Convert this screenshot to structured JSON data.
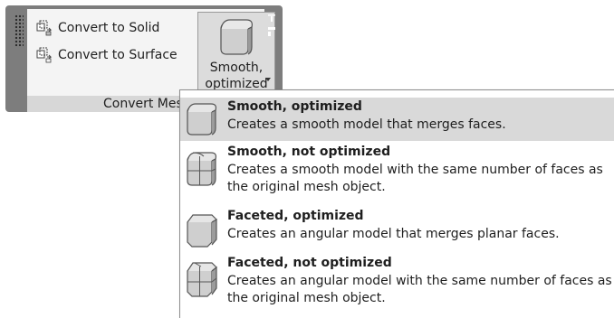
{
  "ribbon": {
    "convert_to_solid": "Convert to Solid",
    "convert_to_surface": "Convert to Surface",
    "smooth_button_line1": "Smooth,",
    "smooth_button_line2": "optimized",
    "panel_title": "Convert Mes"
  },
  "menu": {
    "options": [
      {
        "title": "Smooth, optimized",
        "desc": "Creates a smooth model that merges faces.",
        "icon": "smooth-cube-icon"
      },
      {
        "title": "Smooth, not optimized",
        "desc": "Creates a smooth model with the same number of faces as the original mesh object.",
        "icon": "smooth-grid-cube-icon"
      },
      {
        "title": "Faceted, optimized",
        "desc": "Creates an angular model that merges planar faces.",
        "icon": "faceted-cube-icon"
      },
      {
        "title": "Faceted, not optimized",
        "desc": "Creates an angular model with the same number of faces as the original mesh object.",
        "icon": "faceted-grid-cube-icon"
      }
    ],
    "selected_index": 0
  },
  "colors": {
    "panel_frame": "#7d7d7d",
    "panel_bg": "#f4f4f4",
    "highlight": "#d9d9d9"
  }
}
